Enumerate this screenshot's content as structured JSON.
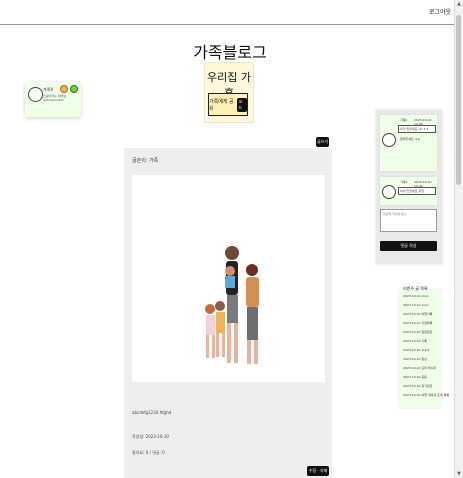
{
  "header": {
    "logout_label": "로그아웃"
  },
  "blog": {
    "title": "가족블로그",
    "family_name": "우리집 가훈",
    "invite_label": "가족에게 공유",
    "invite_code_label": "코드"
  },
  "profile": {
    "name": "가족4",
    "email_line": "안녕이라는 이메일",
    "id_line": "asdsdsdsdsds"
  },
  "post": {
    "author": "글쓴이: 가족",
    "body": "abcdefg1234 hfghd",
    "date": "작성일: 2023-10-10",
    "likes": "좋아요: 0 / 댓글: 0",
    "edit_label": "수정 · 삭제"
  },
  "toolbar": {
    "new_post_label": "글쓰기"
  },
  "comments": {
    "items": [
      {
        "name": "가족1",
        "date": "2023-10-10 10:00",
        "text": "이거 맛있네요 (3) 3.3",
        "extra": "알려주세요 ㅎㅎ"
      },
      {
        "name": "가족1",
        "date": "2023-10-10 10:00",
        "text": "아이 맛있네요 추천"
      }
    ],
    "input_placeholder": "댓글을 작성하세요...",
    "submit_label": "댓글 작성"
  },
  "recent": {
    "title": "이번주 글 목록",
    "items": [
      "2023-10-10 xxxx",
      "2023-10-10 xxxx",
      "2023-10-10 여행기록",
      "2023-10-10 할일목록",
      "2023-10-10 일정관련",
      "2023-10-10 기록",
      "2023-10-10 ㅎㅎㅎ",
      "2023-10-10 일상",
      "2023-10-10 요리 레시피",
      "2023-10-10 운동",
      "2023-10-10 휴가관련",
      "2023-10-10 여행 계획과 준비 목록"
    ]
  },
  "colors": {
    "accent_green": "#f0ffe8",
    "accent_yellow": "#fff7d9",
    "dark": "#111111"
  }
}
